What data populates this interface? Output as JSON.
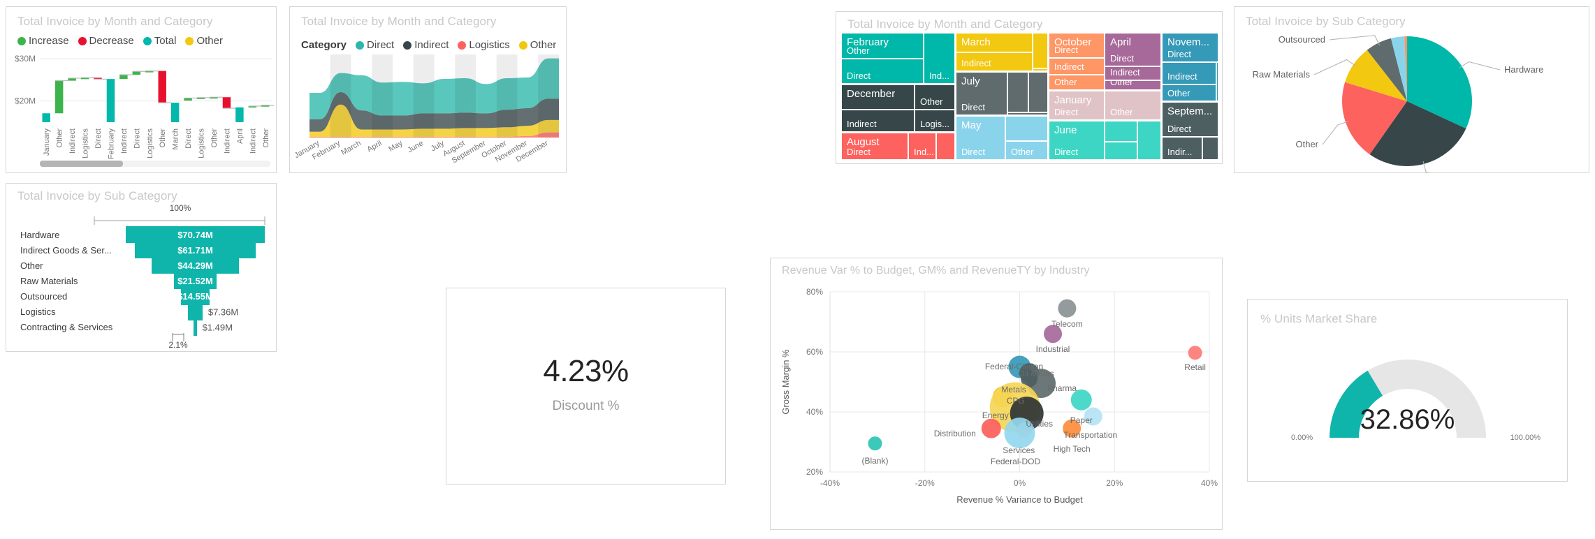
{
  "panels": {
    "waterfall": {
      "title": "Total Invoice by Month and Category",
      "legend": [
        {
          "label": "Increase",
          "color": "#3cb44b"
        },
        {
          "label": "Decrease",
          "color": "#e8112d"
        },
        {
          "label": "Total",
          "color": "#01b8aa"
        },
        {
          "label": "Other",
          "color": "#f2c811"
        }
      ],
      "y_ticks": [
        "$30M",
        "$20M"
      ],
      "scrollbar": {
        "thumb_pct": 36
      }
    },
    "stream": {
      "title": "Total Invoice by Month and Category",
      "legend_title": "Category",
      "legend": [
        {
          "label": "Direct",
          "color": "#2bb7ab"
        },
        {
          "label": "Indirect",
          "color": "#374649"
        },
        {
          "label": "Logistics",
          "color": "#fd625e"
        },
        {
          "label": "Other",
          "color": "#f2c80f"
        }
      ]
    },
    "treemap": {
      "title": "Total Invoice by Month and Category"
    },
    "pie": {
      "title": "Total Invoice by Sub Category"
    },
    "funnel": {
      "title": "Total Invoice by Sub Category",
      "top_label": "100%",
      "bottom_label": "2.1%"
    },
    "kpi": {
      "value": "4.23%",
      "label": "Discount %"
    },
    "scatter": {
      "title": "Revenue Var % to Budget, GM% and RevenueTY by Industry"
    },
    "gauge": {
      "title": "% Units Market Share",
      "value": "32.86%",
      "min_label": "0.00%",
      "max_label": "100.00%"
    }
  },
  "chart_data": [
    {
      "id": "waterfall",
      "type": "bar",
      "title": "Total Invoice by Month and Category",
      "xlabel": "",
      "ylabel": "",
      "ylim": [
        14.5,
        31
      ],
      "ytick_values": [
        30,
        20
      ],
      "ytick_labels": [
        "$30M",
        "$20M"
      ],
      "grid": true,
      "legend": [
        "Increase",
        "Decrease",
        "Total",
        "Other"
      ],
      "categories": [
        "January",
        "Other",
        "Indirect",
        "Logistics",
        "Direct",
        "February",
        "Indirect",
        "Direct",
        "Logistics",
        "Other",
        "March",
        "Direct",
        "Logistics",
        "Other",
        "Indirect",
        "April",
        "Indirect",
        "Other"
      ],
      "kinds": [
        "total",
        "increase",
        "increase",
        "increase",
        "decrease",
        "total",
        "increase",
        "increase",
        "increase",
        "decrease",
        "total",
        "increase",
        "increase",
        "increase",
        "decrease",
        "total",
        "increase",
        "increase"
      ],
      "bar_start": [
        15.0,
        17.1,
        24.8,
        25.4,
        25.5,
        15.0,
        25.2,
        26.2,
        27.0,
        19.6,
        15.0,
        20.1,
        20.7,
        20.8,
        18.3,
        15.0,
        18.5,
        18.8
      ],
      "bar_end": [
        17.1,
        24.8,
        25.4,
        25.5,
        25.2,
        25.2,
        26.2,
        27.0,
        27.1,
        27.1,
        19.6,
        20.7,
        20.8,
        20.9,
        20.9,
        18.5,
        18.8,
        19.0
      ]
    },
    {
      "id": "stream",
      "type": "area",
      "title": "Total Invoice by Month and Category",
      "xlabel": "",
      "ylabel": "",
      "grid": false,
      "legend_position": "top",
      "categories": [
        "January",
        "February",
        "March",
        "April",
        "May",
        "June",
        "July",
        "August",
        "September",
        "October",
        "November",
        "December"
      ],
      "series": [
        {
          "name": "Other",
          "color": "#f2c80f",
          "values": [
            7,
            44,
            10,
            10,
            10,
            11,
            11,
            12,
            12,
            13,
            14,
            17
          ]
        },
        {
          "name": "Logistics",
          "color": "#fd625e",
          "values": [
            1,
            1,
            1,
            1,
            1,
            1,
            1,
            1,
            1,
            1,
            2,
            7
          ]
        },
        {
          "name": "Indirect",
          "color": "#374649",
          "values": [
            17,
            17,
            26,
            19,
            19,
            21,
            21,
            21,
            20,
            24,
            24,
            29
          ]
        },
        {
          "name": "Direct",
          "color": "#2bb7ab",
          "values": [
            36,
            26,
            48,
            45,
            46,
            41,
            47,
            47,
            40,
            43,
            42,
            55
          ]
        }
      ]
    },
    {
      "id": "treemap",
      "type": "treemap",
      "title": "Total Invoice by Month and Category",
      "groups": [
        {
          "month": "February",
          "color": "#00b8a9",
          "children": [
            {
              "label": "Other",
              "value": 30
            },
            {
              "label": "Direct",
              "value": 26
            },
            {
              "label": "Ind...",
              "value": 10
            }
          ]
        },
        {
          "month": "December",
          "color": "#374649",
          "children": [
            {
              "label": "Other",
              "value": 18
            },
            {
              "label": "Indirect",
              "value": 20
            },
            {
              "label": "Logis...",
              "value": 9
            }
          ]
        },
        {
          "month": "August",
          "color": "#fd625e",
          "children": [
            {
              "label": "Direct",
              "value": 22
            },
            {
              "label": "Ind...",
              "value": 9
            }
          ]
        },
        {
          "month": "March",
          "color": "#f2c811",
          "children": [
            {
              "label": "Indirect",
              "value": 30
            },
            {
              "label": "",
              "value": 6
            }
          ]
        },
        {
          "month": "July",
          "color": "#5f6b6d",
          "children": [
            {
              "label": "Direct",
              "value": 26
            },
            {
              "label": "",
              "value": 8
            },
            {
              "label": "",
              "value": 7
            }
          ]
        },
        {
          "month": "May",
          "color": "#8ad4eb",
          "children": [
            {
              "label": "Direct",
              "value": 18
            },
            {
              "label": "Other",
              "value": 11
            }
          ]
        },
        {
          "month": "October",
          "color": "#fe9666",
          "children": [
            {
              "label": "Direct",
              "value": 16
            },
            {
              "label": "Indirect",
              "value": 10
            },
            {
              "label": "Other",
              "value": 8
            }
          ]
        },
        {
          "month": "January",
          "color": "#e0c3c6",
          "children": [
            {
              "label": "Direct",
              "value": 14
            },
            {
              "label": "Other",
              "value": 9
            }
          ]
        },
        {
          "month": "June",
          "color": "#3dd6c4",
          "children": [
            {
              "label": "Direct",
              "value": 12
            },
            {
              "label": "",
              "value": 7
            }
          ]
        },
        {
          "month": "April",
          "color": "#a66999",
          "children": [
            {
              "label": "Direct",
              "value": 16
            },
            {
              "label": "Indirect",
              "value": 8
            },
            {
              "label": "Other",
              "value": 7
            }
          ]
        },
        {
          "month": "Novem...",
          "color": "#3599b8",
          "children": [
            {
              "label": "Direct",
              "value": 15
            },
            {
              "label": "Indirect",
              "value": 9
            },
            {
              "label": "Other",
              "value": 7
            }
          ]
        },
        {
          "month": "Septem...",
          "color": "#4e5f62",
          "children": [
            {
              "label": "Direct",
              "value": 14
            },
            {
              "label": "Indir...",
              "value": 6
            }
          ]
        }
      ]
    },
    {
      "id": "pie",
      "type": "pie",
      "title": "Total Invoice by Sub Category",
      "labels": [
        "Hardware",
        "Indirect Goods & Services",
        "Other",
        "Raw Materials",
        "Outsourced",
        "Logistics",
        "Contracting & Services"
      ],
      "values": [
        70.74,
        61.71,
        44.29,
        21.52,
        14.55,
        7.36,
        1.49
      ],
      "colors": [
        "#00b8a9",
        "#374649",
        "#fd625e",
        "#f2c811",
        "#5f6b6d",
        "#8ad4eb",
        "#fe9666"
      ]
    },
    {
      "id": "funnel",
      "type": "bar",
      "title": "Total Invoice by Sub Category",
      "orientation": "funnel",
      "categories": [
        "Hardware",
        "Indirect Goods & Ser...",
        "Other",
        "Raw Materials",
        "Outsourced",
        "Logistics",
        "Contracting & Services"
      ],
      "values": [
        70.74,
        61.71,
        44.29,
        21.52,
        14.55,
        7.36,
        1.49
      ],
      "value_labels": [
        "$70.74M",
        "$61.71M",
        "$44.29M",
        "$21.52M",
        "$14.55M",
        "$7.36M",
        "$1.49M"
      ],
      "top_pct": "100%",
      "bottom_pct": "2.1%",
      "color": "#0fb5ab"
    },
    {
      "id": "kpi",
      "type": "table",
      "title": "Discount %",
      "value": "4.23%"
    },
    {
      "id": "scatter",
      "type": "scatter",
      "title": "Revenue Var % to Budget, GM% and RevenueTY by Industry",
      "xlabel": "Revenue % Variance to Budget",
      "ylabel": "Gross Margin %",
      "xlim": [
        -40,
        40
      ],
      "ylim": [
        20,
        80
      ],
      "xticks": [
        -40,
        -20,
        0,
        20,
        40
      ],
      "xtick_labels": [
        "-40%",
        "-20%",
        "0%",
        "20%",
        "40%"
      ],
      "yticks": [
        20,
        40,
        60,
        80
      ],
      "ytick_labels": [
        "20%",
        "40%",
        "60%",
        "80%"
      ],
      "grid": true,
      "points": [
        {
          "label": "Telecom",
          "x": 10.0,
          "y": 74.5,
          "size": 13,
          "color": "#8a9394",
          "label_dx": 0,
          "label_dy": 15
        },
        {
          "label": "Industrial",
          "x": 7.0,
          "y": 66.0,
          "size": 13,
          "color": "#a66999",
          "label_dx": 0,
          "label_dy": 15
        },
        {
          "label": "Retail",
          "x": 37.0,
          "y": 59.7,
          "size": 10,
          "color": "#fd7b74",
          "label_dx": 0,
          "label_dy": 14
        },
        {
          "label": "Federal-Civilian",
          "x": 0.0,
          "y": 55.0,
          "size": 16,
          "color": "#3599b8",
          "label_dx": -8,
          "label_dy": -8
        },
        {
          "label": "Oil & Gas",
          "x": 2.0,
          "y": 53.0,
          "size": 14,
          "color": "#4a5c5e",
          "label_dx": 10,
          "label_dy": -6
        },
        {
          "label": "Pharma",
          "x": 4.5,
          "y": 49.5,
          "size": 21,
          "color": "#5f6b6d",
          "label_dx": 30,
          "label_dy": 0
        },
        {
          "label": "Metals",
          "x": 2.0,
          "y": 51.0,
          "size": 12,
          "color": "#4e5f62",
          "label_dx": -22,
          "label_dy": 8
        },
        {
          "label": "CPG",
          "x": -3.5,
          "y": 45.0,
          "size": 15,
          "color": "#f2c811",
          "label_dx": 18,
          "label_dy": -2
        },
        {
          "label": "Energy",
          "x": -1.0,
          "y": 41.5,
          "size": 36,
          "color": "#f5d657",
          "label_dx": -28,
          "label_dy": 4
        },
        {
          "label": "Paper",
          "x": 13.0,
          "y": 44.0,
          "size": 15,
          "color": "#3dd6c4",
          "label_dx": 0,
          "label_dy": 22
        },
        {
          "label": "Utilities",
          "x": 1.5,
          "y": 39.5,
          "size": 24,
          "color": "#2c3435",
          "label_dx": 18,
          "label_dy": 8
        },
        {
          "label": "Transportation",
          "x": 15.5,
          "y": 38.5,
          "size": 13,
          "color": "#b4e3f5",
          "label_dx": -4,
          "label_dy": 20
        },
        {
          "label": "Distribution",
          "x": -6.0,
          "y": 34.5,
          "size": 14,
          "color": "#fd5e5a",
          "label_dx": -52,
          "label_dy": 0
        },
        {
          "label": "Services",
          "x": 1.0,
          "y": 34.0,
          "size": 11,
          "color": "#fbb28a",
          "label_dx": -8,
          "label_dy": 22
        },
        {
          "label": "Federal-DOD",
          "x": 0.0,
          "y": 33.0,
          "size": 22,
          "color": "#94d7ef",
          "label_dx": -6,
          "label_dy": 34
        },
        {
          "label": "High Tech",
          "x": 11.0,
          "y": 34.5,
          "size": 13,
          "color": "#fd8d3c",
          "label_dx": 0,
          "label_dy": 22
        },
        {
          "label": "(Blank)",
          "x": -30.5,
          "y": 29.5,
          "size": 10,
          "color": "#2bc4b4",
          "label_dx": 0,
          "label_dy": 18
        }
      ]
    },
    {
      "id": "gauge",
      "type": "pie",
      "title": "% Units Market Share",
      "value": 32.86,
      "min": 0,
      "max": 100,
      "value_label": "32.86%",
      "min_label": "0.00%",
      "max_label": "100.00%",
      "fill_color": "#0fb5ab",
      "track_color": "#e6e6e6"
    }
  ]
}
